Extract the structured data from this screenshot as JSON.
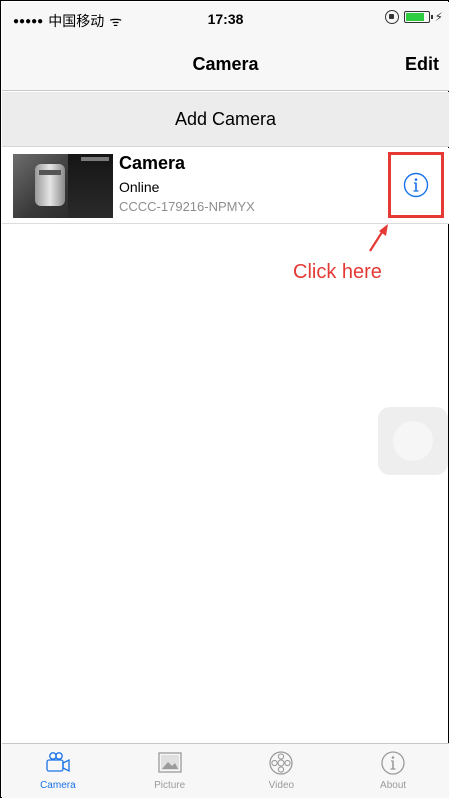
{
  "status_bar": {
    "signal_dots": "●●●●●",
    "carrier": "中国移动",
    "wifi": "ᯤ",
    "time": "17:38",
    "charging_symbol": "⚡"
  },
  "nav": {
    "title": "Camera",
    "edit_label": "Edit"
  },
  "add_camera_label": "Add Camera",
  "cameras": [
    {
      "name": "Camera",
      "status": "Online",
      "id": "CCCC-179216-NPMYX"
    }
  ],
  "annotation": {
    "text": "Click here",
    "color": "#e53935"
  },
  "tabs": [
    {
      "label": "Camera",
      "icon": "camera-icon",
      "active": true
    },
    {
      "label": "Picture",
      "icon": "picture-icon",
      "active": false
    },
    {
      "label": "Video",
      "icon": "video-icon",
      "active": false
    },
    {
      "label": "About",
      "icon": "about-icon",
      "active": false
    }
  ],
  "colors": {
    "accent": "#1a73e8",
    "annotation_red": "#e53935",
    "inactive_tab": "#9b9b9b"
  }
}
